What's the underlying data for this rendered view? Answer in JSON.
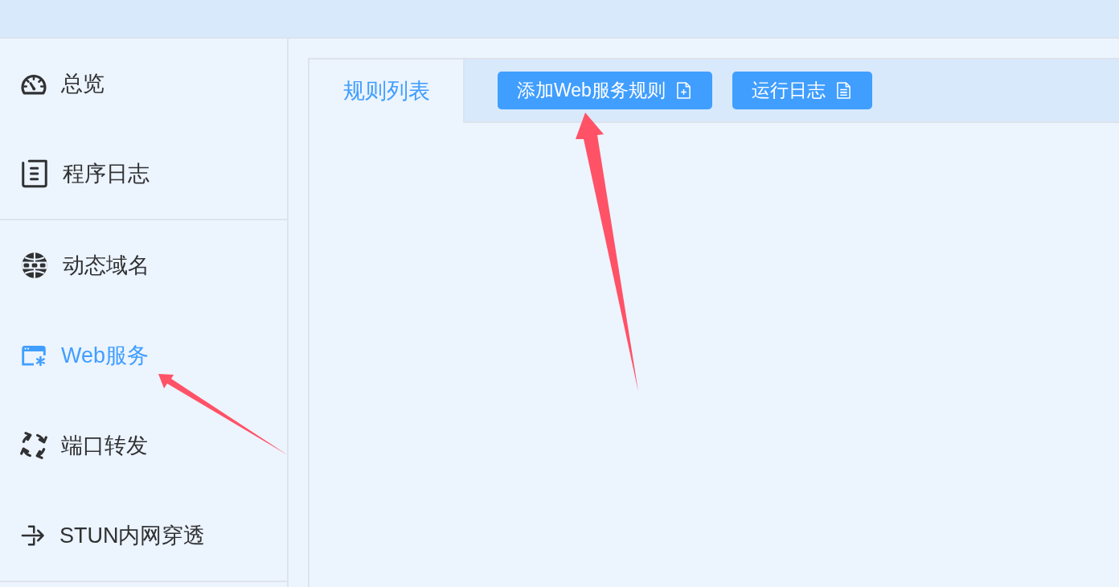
{
  "sidebar": {
    "groups": [
      {
        "items": [
          {
            "label": "总览",
            "selected": false
          },
          {
            "label": "程序日志",
            "selected": false
          }
        ]
      },
      {
        "items": [
          {
            "label": "动态域名",
            "selected": false
          },
          {
            "label": "Web服务",
            "selected": true
          },
          {
            "label": "端口转发",
            "selected": false
          },
          {
            "label": "STUN内网穿透",
            "selected": false
          }
        ]
      }
    ]
  },
  "panel": {
    "tabs": [
      {
        "label": "规则列表",
        "selected": true
      }
    ],
    "buttons": [
      {
        "label": "添加Web服务规则"
      },
      {
        "label": "运行日志"
      }
    ]
  }
}
